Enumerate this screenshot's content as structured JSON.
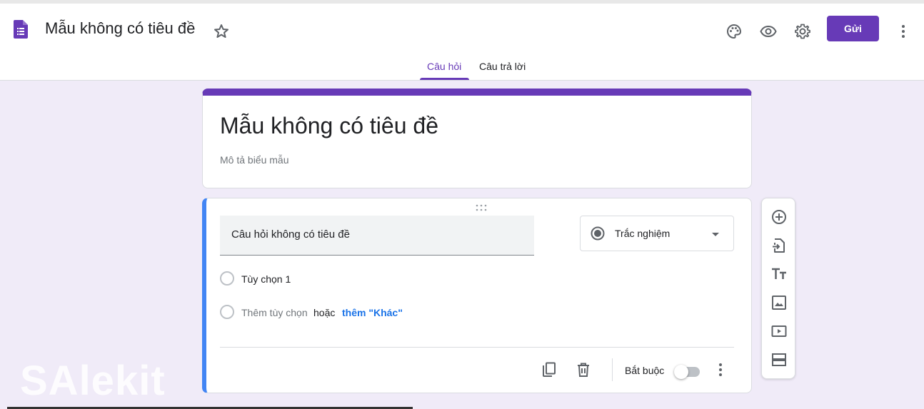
{
  "header": {
    "doc_title": "Mẫu không có tiêu đề",
    "send_label": "Gửi",
    "tabs": [
      {
        "label": "Câu hỏi",
        "active": true
      },
      {
        "label": "Câu trả lời",
        "active": false
      }
    ],
    "icons": [
      "forms-app-icon",
      "star-icon",
      "palette-icon",
      "preview-eye-icon",
      "settings-gear-icon",
      "more-vert-icon"
    ]
  },
  "form": {
    "title": "Mẫu không có tiêu đề",
    "description": "Mô tả biểu mẫu"
  },
  "question": {
    "title": "Câu hỏi không có tiêu đề",
    "type_label": "Trắc nghiệm",
    "options": [
      "Tùy chọn 1"
    ],
    "add_option": "Thêm tùy chọn",
    "or_text": "hoặc",
    "add_other": "thêm \"Khác\"",
    "required_label": "Bắt buộc",
    "required": false
  },
  "sidebar": {
    "icons": [
      "add-question-icon",
      "import-questions-icon",
      "add-title-icon",
      "add-image-icon",
      "add-video-icon",
      "add-section-icon"
    ]
  },
  "watermark": "SAlekit",
  "colors": {
    "accent": "#673ab7",
    "background": "#f0ebf8",
    "active_border": "#4285f4",
    "link": "#1a73e8"
  }
}
